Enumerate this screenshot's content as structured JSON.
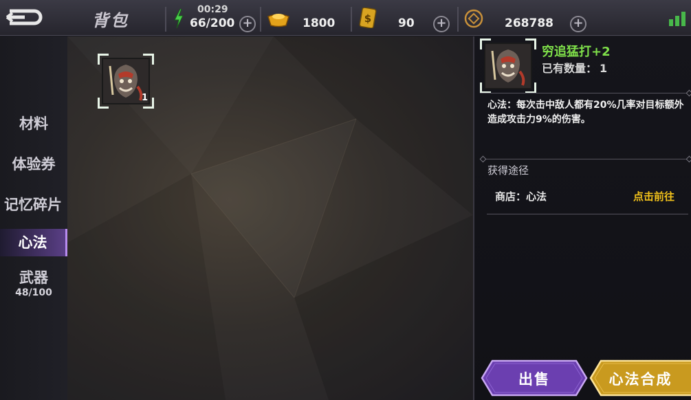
{
  "header": {
    "title": "背包",
    "energy": {
      "timer": "00:29",
      "value": "66/200"
    },
    "gold": "1800",
    "tickets": "90",
    "coins": "268788"
  },
  "sidebar": {
    "items": [
      {
        "label": "材料",
        "active": false
      },
      {
        "label": "体验券",
        "active": false
      },
      {
        "label": "记忆碎片",
        "active": false
      },
      {
        "label": "心法",
        "active": true
      },
      {
        "label": "武器",
        "sub": "48/100",
        "active": false
      }
    ]
  },
  "inventory": {
    "items": [
      {
        "count": "1"
      }
    ]
  },
  "detail": {
    "name": "穷追猛打+2",
    "owned_label": "已有数量：",
    "owned_value": "1",
    "description": "心法：每次击中敌人都有20%几率对目标额外造成攻击力9%的伤害。",
    "source_title": "获得途径",
    "source_label": "商店：心法",
    "goto_label": "点击前往",
    "sell_label": "出售",
    "combine_label": "心法合成"
  },
  "colors": {
    "item_name": "#7fe04a",
    "goto": "#f2c21a",
    "active_tab": "#5a3f86",
    "sell_button": "#6b3fb0",
    "combine_button": "#c99a1f"
  }
}
